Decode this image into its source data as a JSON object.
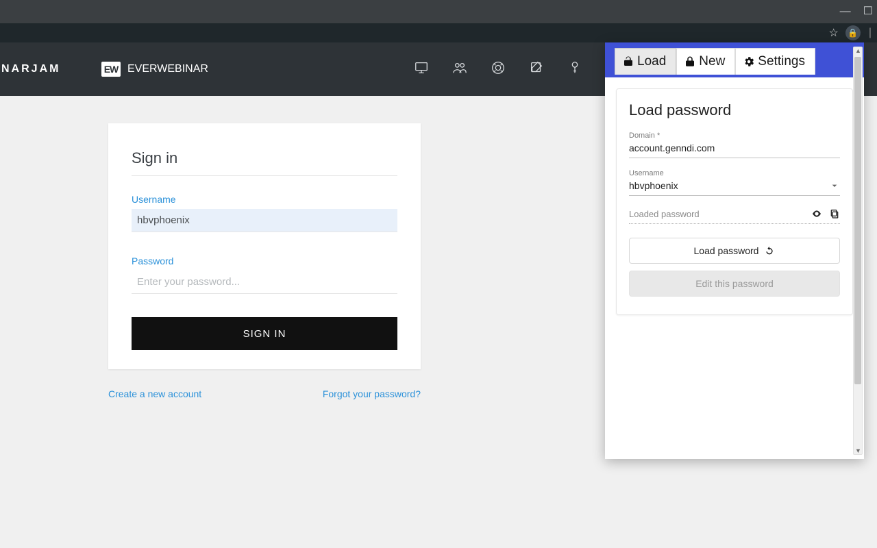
{
  "window": {
    "min": "—",
    "max": "☐"
  },
  "browser": {
    "star": "☆",
    "lock": "🔒",
    "pipe": "|"
  },
  "header": {
    "brand_partial": "NARJAM",
    "logo_text": "EW",
    "brand_name": "EVERWEBINAR"
  },
  "signin": {
    "title": "Sign in",
    "username_label": "Username",
    "username_value": "hbvphoenix",
    "password_label": "Password",
    "password_placeholder": "Enter your password...",
    "button": "SIGN IN",
    "create_account": "Create a new account",
    "forgot": "Forgot your password?"
  },
  "popup": {
    "tabs": {
      "load": "Load",
      "new": "New",
      "settings": "Settings"
    },
    "panel_title": "Load password",
    "domain_label": "Domain *",
    "domain_value": "account.genndi.com",
    "username_label": "Username",
    "username_value": "hbvphoenix",
    "loaded_label": "Loaded password",
    "load_btn": "Load password",
    "edit_btn": "Edit this password"
  }
}
